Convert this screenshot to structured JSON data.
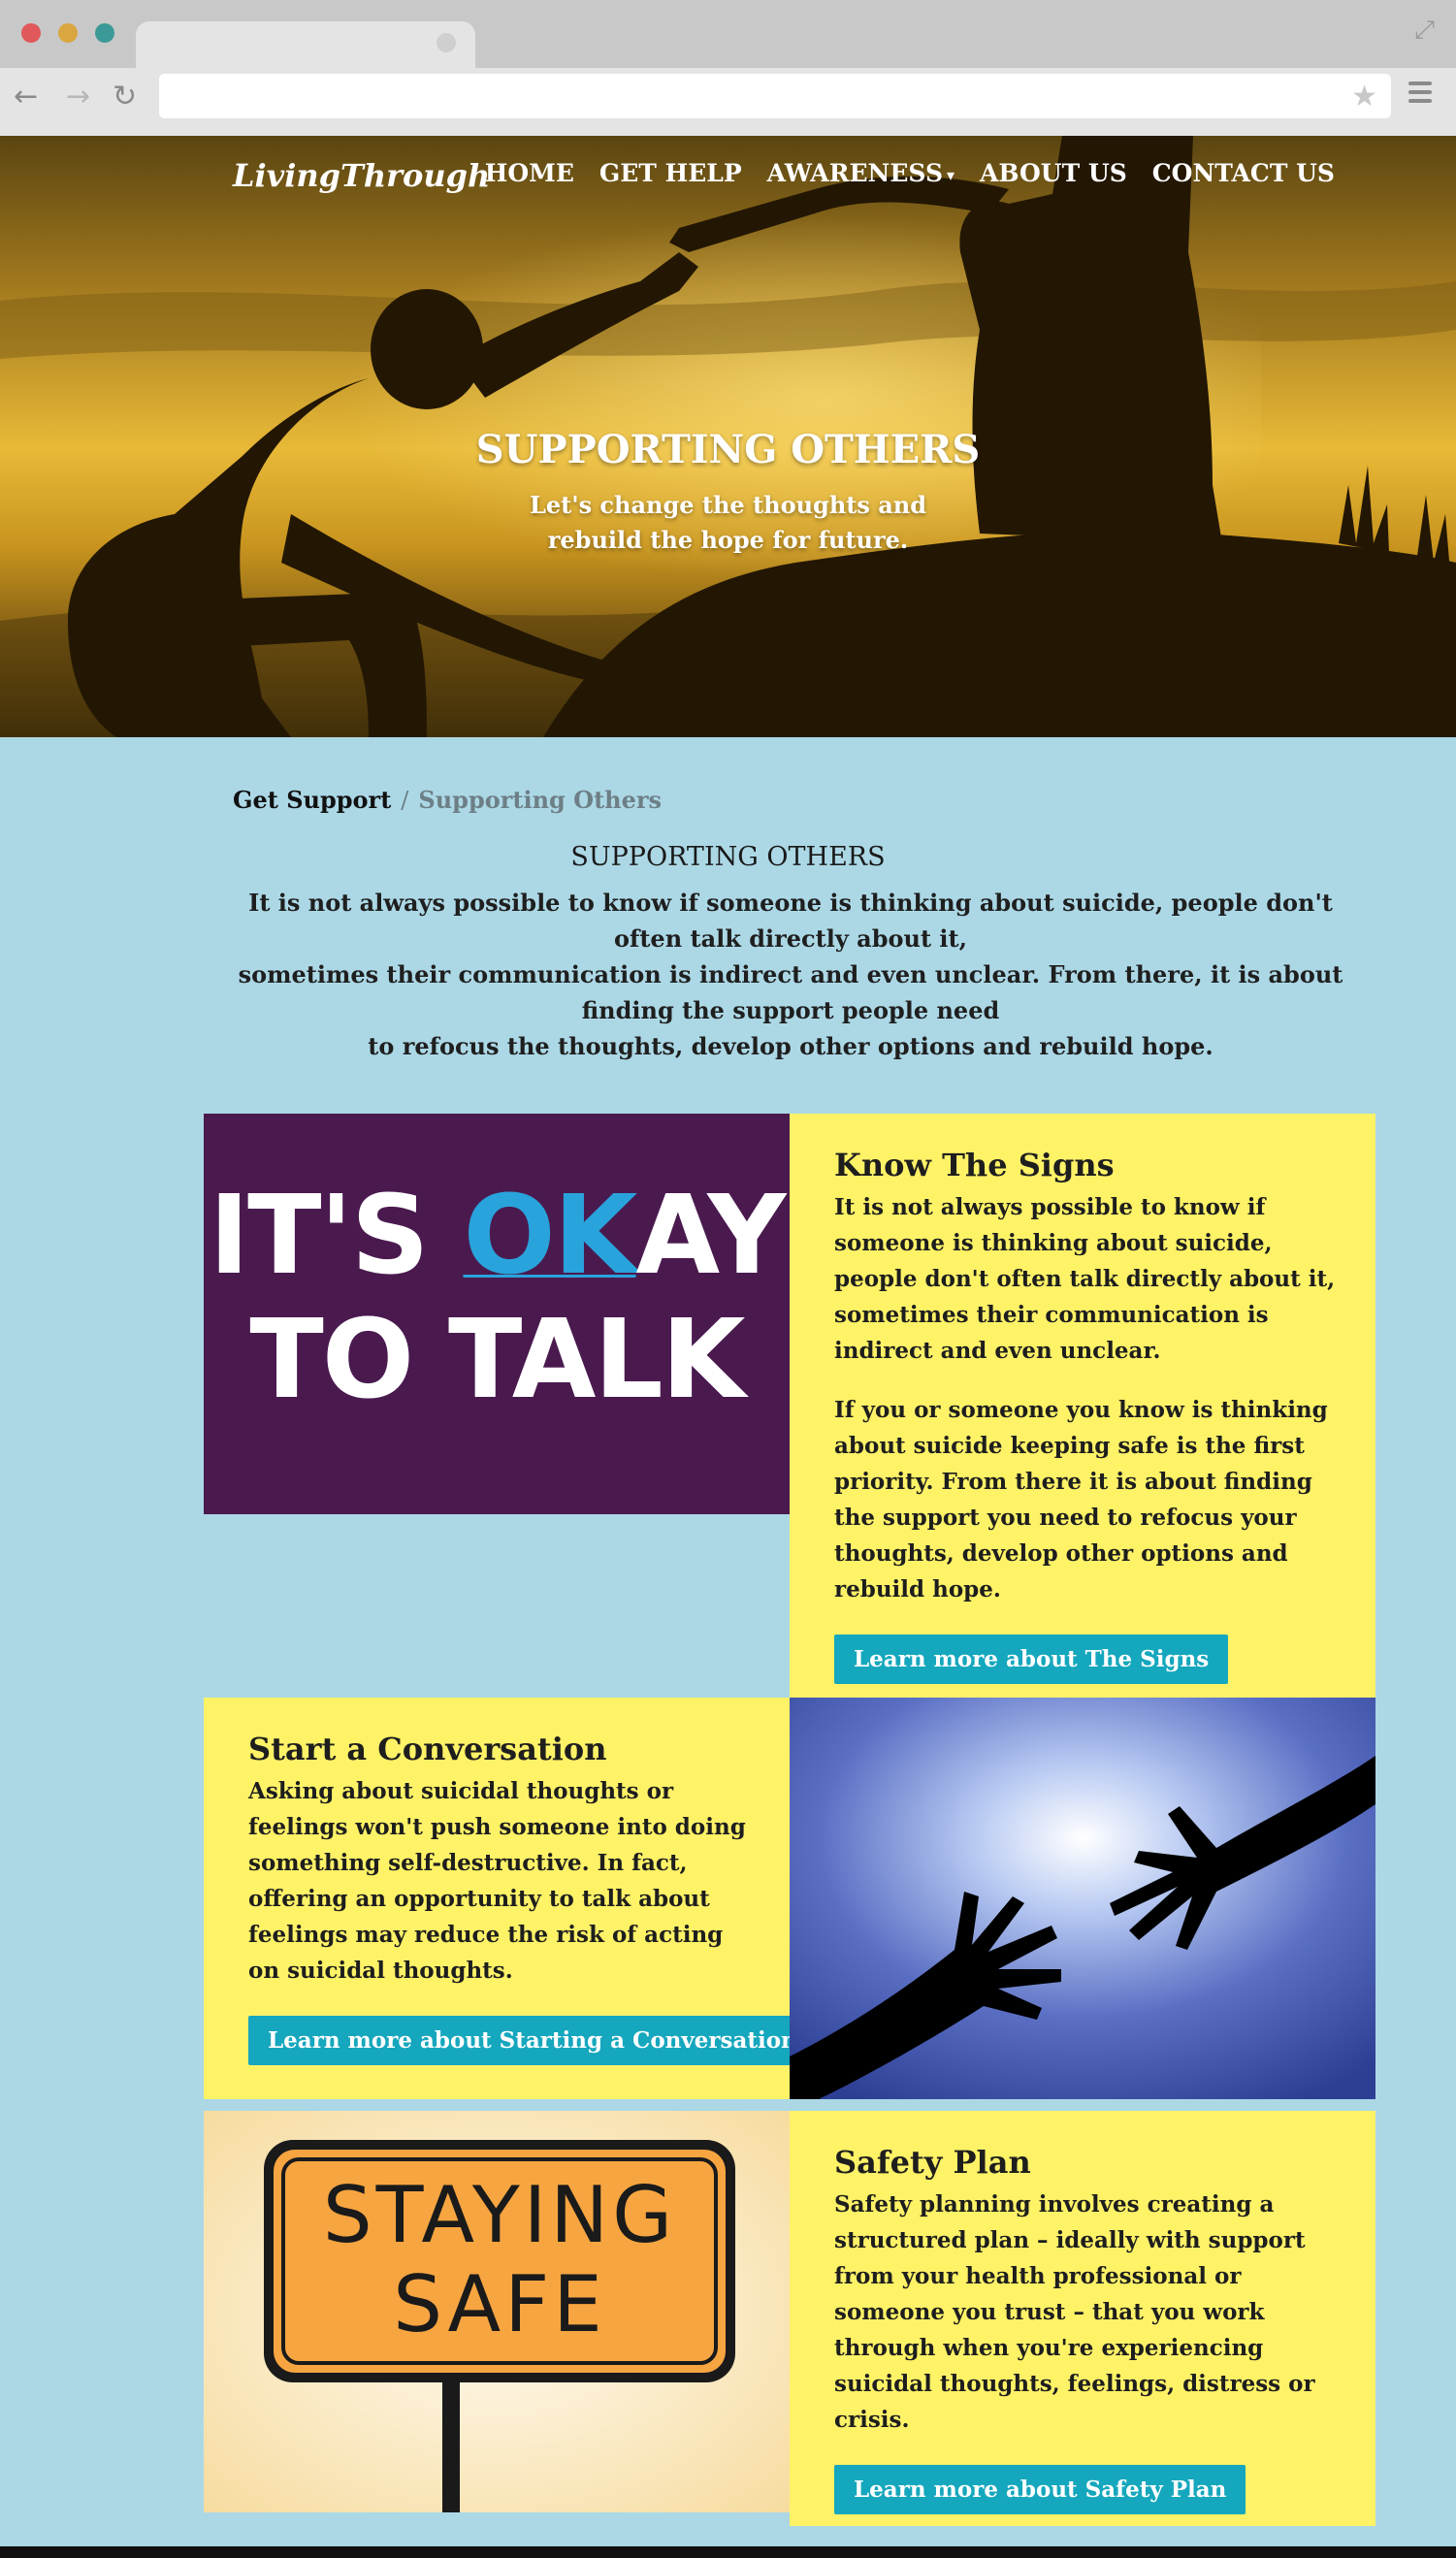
{
  "browser": {
    "url": "",
    "icons": [
      "back-arrow-icon",
      "forward-arrow-icon",
      "reload-icon",
      "star-icon",
      "menu-icon",
      "expand-icon"
    ]
  },
  "header": {
    "logo": "LivingThrough",
    "nav": [
      {
        "label": "HOME"
      },
      {
        "label": "GET HELP"
      },
      {
        "label": "AWARENESS",
        "caret": "▾"
      },
      {
        "label": "ABOUT US"
      },
      {
        "label": "CONTACT US"
      }
    ]
  },
  "hero": {
    "title": "SUPPORTING OTHERS",
    "subtitle_line1": "Let's change the thoughts and",
    "subtitle_line2": "rebuild the hope for future."
  },
  "breadcrumb": {
    "parent": "Get Support",
    "separator": "/",
    "current": "Supporting Others"
  },
  "intro": {
    "title": "SUPPORTING OTHERS",
    "line1": "It is not always possible to know if someone is thinking about suicide, people don't often talk directly about it,",
    "line2": "sometimes their communication is indirect and even unclear. From there, it is about finding the support people need",
    "line3": "to refocus the thoughts, develop other options and rebuild hope."
  },
  "cards": {
    "signs": {
      "image_text_line1_a": "IT'S ",
      "image_text_line1_b": "OK",
      "image_text_line1_c": "AY",
      "image_text_line2": "TO TALK",
      "title": "Know The Signs",
      "p1": "It is not always possible to know if someone is thinking about suicide, people don't often talk directly about it, sometimes their communication is indirect and even unclear.",
      "p2": "If you or someone you know is thinking about suicide keeping safe is the first priority. From there it is about finding the support you need to refocus your thoughts, develop other options and rebuild hope.",
      "button": "Learn more about The Signs"
    },
    "conversation": {
      "title": "Start a Conversation",
      "p1": "Asking about suicidal thoughts or feelings won't push someone into doing something self-destructive. In fact, offering an opportunity to talk about feelings may reduce the risk of acting on suicidal thoughts.",
      "button": "Learn more about Starting a Conversation"
    },
    "safety": {
      "sign_line1": "STAYING",
      "sign_line2": "SAFE",
      "title": "Safety Plan",
      "p1": "Safety planning involves creating a structured plan – ideally with support from your health professional or someone you trust – that you work through when you're experiencing suicidal thoughts, feelings, distress or crisis.",
      "button": "Learn more about Safety Plan"
    }
  },
  "colors": {
    "main_bg": "#acd8e6",
    "panel_bg": "#fef267",
    "button_bg": "#15a7bd",
    "okay_bg": "#4a1a4f",
    "okay_accent": "#29a3dc",
    "sign_orange": "#f7a541"
  }
}
